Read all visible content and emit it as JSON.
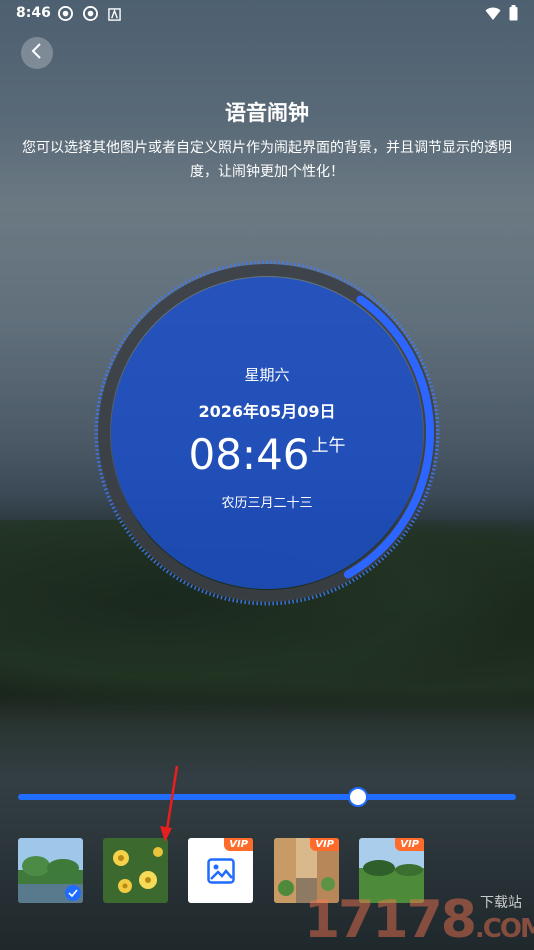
{
  "status_bar": {
    "time": "8:46",
    "icons": [
      "aperture-icon",
      "aperture-icon",
      "a-icon"
    ],
    "right_icons": [
      "wifi-icon",
      "battery-icon"
    ]
  },
  "header": {
    "back_icon": "chevron-left-icon",
    "title": "语音闹钟"
  },
  "description": "您可以选择其他图片或者自定义照片作为闹起界面的背景，并且调节显示的透明度，让闹钟更加个性化！",
  "clock": {
    "weekday": "星期六",
    "date": "2026年05月09日",
    "time": "08:46",
    "ampm": "上午",
    "lunar": "农历三月二十三",
    "colors": {
      "face": "#1d4fc4",
      "ring": "#3b3f45",
      "accent": "#2d66ff"
    },
    "progress": 0.32
  },
  "opacity_slider": {
    "value": 0.68,
    "color": "#1f6cff"
  },
  "backgrounds": [
    {
      "name": "lake-trees",
      "selected": true,
      "vip": false
    },
    {
      "name": "yellow-flowers",
      "selected": false,
      "vip": false
    },
    {
      "name": "custom-photo",
      "selected": false,
      "vip": true,
      "vip_label": "VIP"
    },
    {
      "name": "alley-street",
      "selected": false,
      "vip": true,
      "vip_label": "VIP"
    },
    {
      "name": "green-field",
      "selected": false,
      "vip": true,
      "vip_label": "VIP"
    }
  ],
  "watermark": {
    "big": "17178",
    "suffix": ".COM",
    "small": "下载站"
  }
}
